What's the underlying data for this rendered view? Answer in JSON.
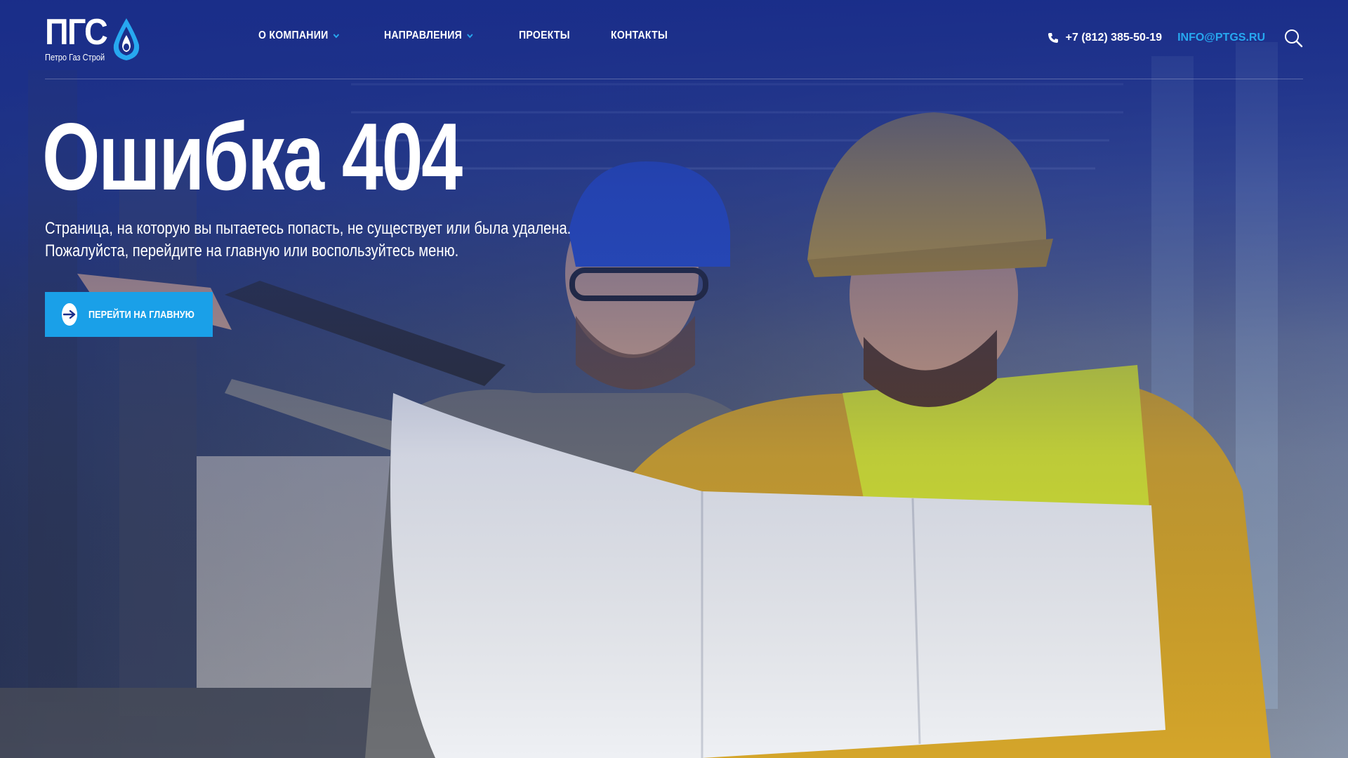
{
  "brand": {
    "logo_text": "ПГС",
    "logo_subtitle": "Петро Газ Строй",
    "accent_color": "#1aa0e8",
    "link_color": "#27a8f0"
  },
  "nav": {
    "items": [
      {
        "label": "О КОМПАНИИ",
        "has_dropdown": true
      },
      {
        "label": "НАПРАВЛЕНИЯ",
        "has_dropdown": true
      },
      {
        "label": "ПРОЕКТЫ",
        "has_dropdown": false
      },
      {
        "label": "КОНТАКТЫ",
        "has_dropdown": false
      }
    ]
  },
  "contacts": {
    "phone_icon": "phone-icon",
    "phone": "+7 (812) 385-50-19",
    "email": "INFO@PTGS.RU",
    "search_icon": "search-icon"
  },
  "hero": {
    "title": "Ошибка 404",
    "text": "Страница, на которую вы пытаетесь попасть, не существует или была удалена. Пожалуйста, перейдите на главную или воспользуйтесь меню.",
    "cta_label": "ПЕРЕЙТИ НА ГЛАВНУЮ",
    "cta_icon": "arrow-right-icon"
  }
}
